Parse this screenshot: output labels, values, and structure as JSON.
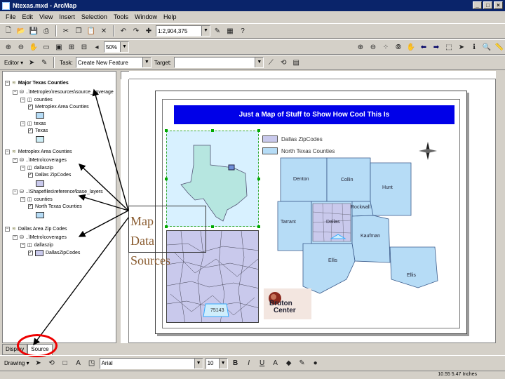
{
  "window": {
    "title": "Ntexas.mxd - ArcMap",
    "controls": [
      "_",
      "□",
      "×"
    ]
  },
  "menu": [
    "File",
    "Edit",
    "View",
    "Insert",
    "Selection",
    "Tools",
    "Window",
    "Help"
  ],
  "toolbar1": {
    "scale_value": "1:2,904,375"
  },
  "toolbar2": {
    "zoom_value": "50%"
  },
  "toolbar3": {
    "editor_label": "Editor ▾",
    "task_label": "Task:",
    "task_value": "Create New Feature",
    "target_label": "Target:",
    "target_value": ""
  },
  "toc": {
    "rows": [
      {
        "label": "Major Texas Counties",
        "bold": true
      },
      {
        "label": "..\\Metroplex\\resources\\source_coverage"
      },
      {
        "label": "counties"
      },
      {
        "label": "Metroplex Area Counties"
      },
      {
        "label": "texas"
      },
      {
        "label": "Texas"
      },
      {
        "label": "Metroplex Area Counties"
      },
      {
        "label": "..\\Metro\\coverages"
      },
      {
        "label": "dallaszip"
      },
      {
        "label": "Dallas ZipCodes"
      },
      {
        "label": "..\\Shapefiles\\reference\\base_layers"
      },
      {
        "label": "counties"
      },
      {
        "label": "North Texas Counties"
      },
      {
        "label": "Dallas Area Zip Codes"
      },
      {
        "label": "..\\Metro\\coverages"
      },
      {
        "label": "dallaszip"
      },
      {
        "label": "DallasZipCodes"
      }
    ],
    "tabs": [
      "Display",
      "Source"
    ]
  },
  "layout": {
    "map_title": "Just a Map of Stuff to Show How Cool This Is",
    "legend": [
      "Dallas ZipCodes",
      "North Texas Counties"
    ],
    "counties": [
      "Denton",
      "Collin",
      "Hunt",
      "Rockwall",
      "Tarrant",
      "Dallas",
      "Kaufman",
      "Ellis",
      "Ellis"
    ],
    "zip_label": "75143",
    "logo_line1": "Bruton",
    "logo_line2": "Center",
    "callout_lines": [
      "Map",
      "Data",
      "Sources"
    ]
  },
  "bottom": {
    "draw_label": "Drawing ▾",
    "font_value": "Arial",
    "size_value": "10",
    "bold": "B",
    "italic": "I",
    "underline": "U"
  },
  "status": {
    "coords": "10.55  5.47 Inches"
  },
  "colors": {
    "titlebar": "#0a246a",
    "map_title_bg": "#0000e8",
    "county_fill": "#b6dcf6",
    "zip_fill": "#c9c9ec",
    "annotation_red": "#e00000"
  }
}
